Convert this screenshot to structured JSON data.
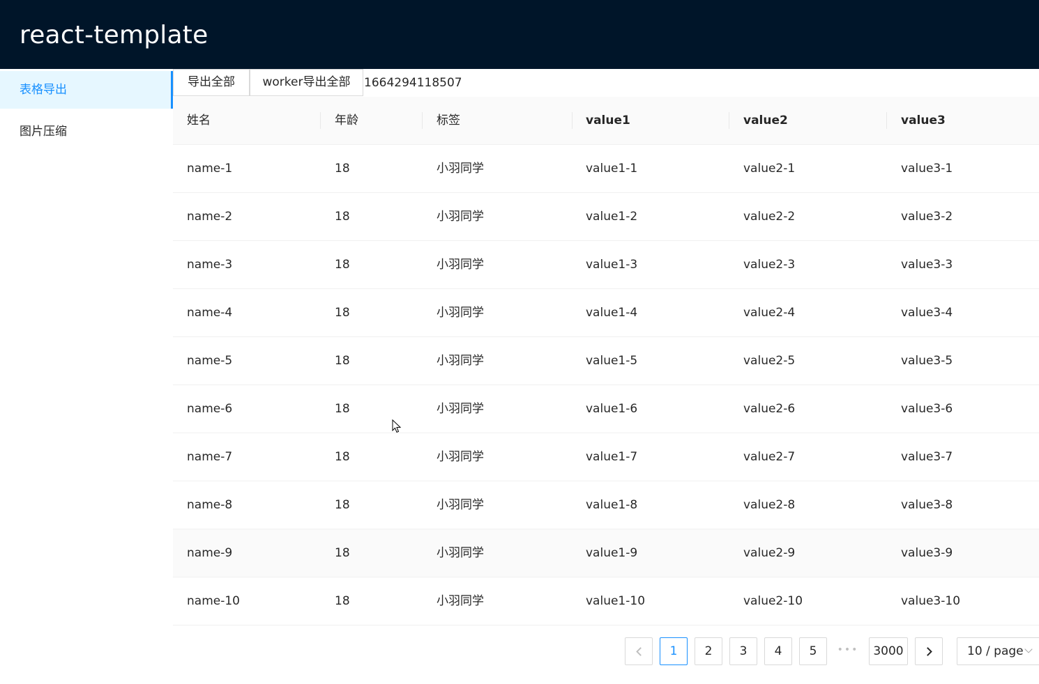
{
  "app": {
    "title": "react-template"
  },
  "sidebar": {
    "items": [
      {
        "label": "表格导出",
        "active": true
      },
      {
        "label": "图片压缩",
        "active": false
      }
    ]
  },
  "toolbar": {
    "export_all_label": "导出全部",
    "worker_export_label": "worker导出全部",
    "timestamp": "1664294118507"
  },
  "table": {
    "columns": [
      "姓名",
      "年龄",
      "标签",
      "value1",
      "value2",
      "value3"
    ],
    "rows": [
      [
        "name-1",
        "18",
        "小羽同学",
        "value1-1",
        "value2-1",
        "value3-1"
      ],
      [
        "name-2",
        "18",
        "小羽同学",
        "value1-2",
        "value2-2",
        "value3-2"
      ],
      [
        "name-3",
        "18",
        "小羽同学",
        "value1-3",
        "value2-3",
        "value3-3"
      ],
      [
        "name-4",
        "18",
        "小羽同学",
        "value1-4",
        "value2-4",
        "value3-4"
      ],
      [
        "name-5",
        "18",
        "小羽同学",
        "value1-5",
        "value2-5",
        "value3-5"
      ],
      [
        "name-6",
        "18",
        "小羽同学",
        "value1-6",
        "value2-6",
        "value3-6"
      ],
      [
        "name-7",
        "18",
        "小羽同学",
        "value1-7",
        "value2-7",
        "value3-7"
      ],
      [
        "name-8",
        "18",
        "小羽同学",
        "value1-8",
        "value2-8",
        "value3-8"
      ],
      [
        "name-9",
        "18",
        "小羽同学",
        "value1-9",
        "value2-9",
        "value3-9"
      ],
      [
        "name-10",
        "18",
        "小羽同学",
        "value1-10",
        "value2-10",
        "value3-10"
      ]
    ],
    "hovered_row": 9
  },
  "pagination": {
    "pages": [
      "1",
      "2",
      "3",
      "4",
      "5"
    ],
    "current": "1",
    "ellipsis": "•••",
    "last_page": "3000",
    "page_size": "10 / page"
  },
  "colors": {
    "header_bg": "#001529",
    "accent": "#1890ff",
    "active_menu_bg": "#e6f7ff"
  }
}
